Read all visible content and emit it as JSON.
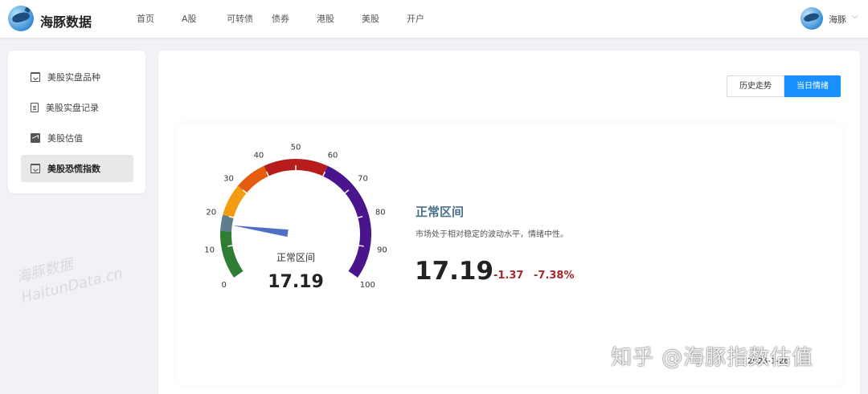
{
  "header": {
    "brand": "海豚数据",
    "nav": [
      "首页",
      "A股",
      "可转债",
      "债券",
      "港股",
      "美股",
      "开户"
    ],
    "user_name": "海豚",
    "user_chevron": "⌵"
  },
  "sidebar": {
    "items": [
      {
        "label": "美股实盘品种",
        "icon": "presentation-board-icon"
      },
      {
        "label": "美股实盘记录",
        "icon": "document-icon"
      },
      {
        "label": "美股估值",
        "icon": "line-chart-icon"
      },
      {
        "label": "美股恐慌指数",
        "icon": "presentation-board-icon",
        "active": true
      }
    ]
  },
  "toolbar": {
    "history_label": "历史走势",
    "today_label": "当日情绪"
  },
  "gauge": {
    "min": 0,
    "max": 100,
    "value": 17.19,
    "label": "正常区间",
    "value_text": "17.19",
    "ticks": [
      "0",
      "10",
      "20",
      "30",
      "40",
      "50",
      "60",
      "70",
      "80",
      "90",
      "100"
    ],
    "bands": [
      {
        "from": 0,
        "to": 15,
        "color": "#2e7d32"
      },
      {
        "from": 15,
        "to": 20,
        "color": "#607d8b"
      },
      {
        "from": 20,
        "to": 30,
        "color": "#f39c12"
      },
      {
        "from": 30,
        "to": 40,
        "color": "#e65c0f"
      },
      {
        "from": 40,
        "to": 60,
        "color": "#b71c1c"
      },
      {
        "from": 60,
        "to": 100,
        "color": "#4a148c"
      }
    ]
  },
  "status": {
    "title": "正常区间",
    "description": "市场处于相对稳定的波动水平，情绪中性。",
    "value": "17.19",
    "change": "-1.37",
    "change_pct": "-7.38%"
  },
  "watermarks": {
    "left_cn": "海豚数据",
    "left_en": "HaitunData.cn",
    "right": "知乎 @海豚指数估值"
  },
  "footer": {
    "date": "2025-1-26"
  }
}
